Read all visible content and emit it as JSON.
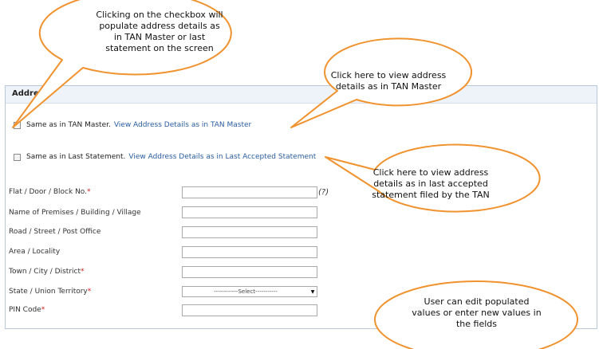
{
  "form": {
    "section_title": "Address",
    "checkbox_tan": {
      "label": "Same as in TAN Master.",
      "link": "View Address Details as in TAN Master"
    },
    "checkbox_last": {
      "label": "Same as in Last Statement.",
      "link": "View Address Details as in Last Accepted Statement"
    },
    "fields": [
      {
        "label": "Flat / Door / Block No.",
        "required": true
      },
      {
        "label": "Name of Premises / Building / Village",
        "required": false
      },
      {
        "label": "Road / Street / Post Office",
        "required": false
      },
      {
        "label": "Area / Locality",
        "required": false
      },
      {
        "label": "Town / City / District",
        "required": true
      },
      {
        "label": "State / Union Territory",
        "required": true
      },
      {
        "label": "PIN Code",
        "required": true
      }
    ],
    "required_mark": "*",
    "help_glyph": "(?)",
    "state_select_value": "------------Select-----------"
  },
  "callouts": {
    "checkbox": "Clicking on the checkbox will populate address details as in TAN Master or last statement on the screen",
    "tan_master": "Click here to view address details as in TAN Master",
    "last_statement": "Click here to view address details as in last accepted statement filed by the TAN",
    "edit": "User can edit populated values or enter new values in the fields"
  },
  "colors": {
    "callout_border": "#f0922e",
    "link": "#2a5d9f",
    "required": "#d02020"
  }
}
